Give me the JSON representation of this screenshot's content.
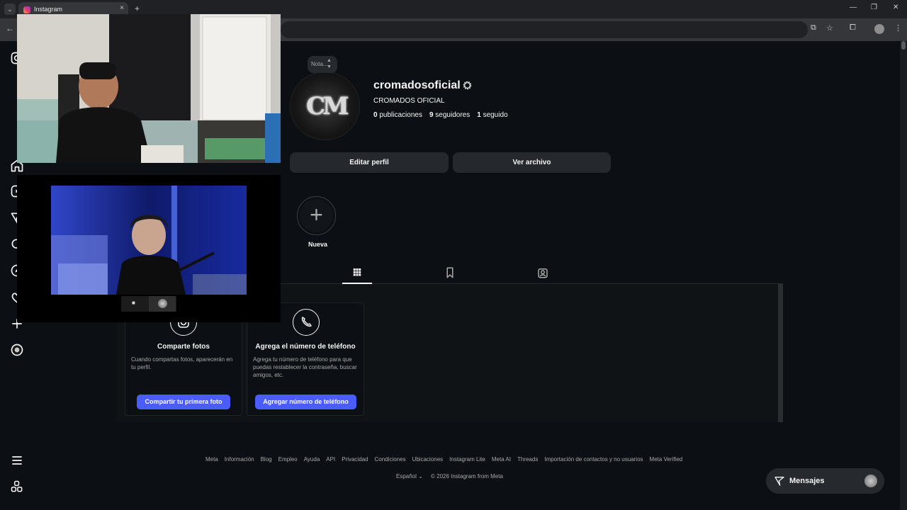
{
  "browser": {
    "tab_title": "Instagram",
    "new_tab_symbol": "+",
    "close_symbol": "×",
    "dropdown_symbol": "⌄",
    "window_controls": [
      "—",
      "❐",
      "✕"
    ]
  },
  "profile": {
    "note_placeholder": "Nota...",
    "username": "cromadosoficial",
    "full_name": "CROMADOS OFICIAL",
    "avatar_logo": "CM",
    "stats": {
      "posts_count": "0",
      "posts_label": "publicaciones",
      "followers_count": "9",
      "followers_label": "seguidores",
      "following_count": "1",
      "following_label": "seguido"
    },
    "edit_profile_label": "Editar perfil",
    "view_archive_label": "Ver archivo",
    "new_highlight_label": "Nueva"
  },
  "cards": [
    {
      "title": "Comparte fotos",
      "description": "Cuando compartas fotos, aparecerán en tu perfil.",
      "button_label": "Compartir tu primera foto"
    },
    {
      "title": "Agrega el número de teléfono",
      "description": "Agrega tu número de teléfono para que puedas restablecer la contraseña, buscar amigos, etc.",
      "button_label": "Agregar número de teléfono"
    }
  ],
  "footer": {
    "links": [
      "Meta",
      "Información",
      "Blog",
      "Empleo",
      "Ayuda",
      "API",
      "Privacidad",
      "Condiciones",
      "Ubicaciones",
      "Instagram Lite",
      "Meta AI",
      "Threads",
      "Importación de contactos y no usuarios",
      "Meta Verified"
    ],
    "language": "Español",
    "copyright": "© 2026 Instagram from Meta"
  },
  "messages": {
    "label": "Mensajes"
  },
  "colors": {
    "background": "#0c1014",
    "button_bg": "#25292e",
    "accent_blue": "#4a5df9",
    "text_primary": "#f5f5f5",
    "text_secondary": "#a8a8a8"
  }
}
